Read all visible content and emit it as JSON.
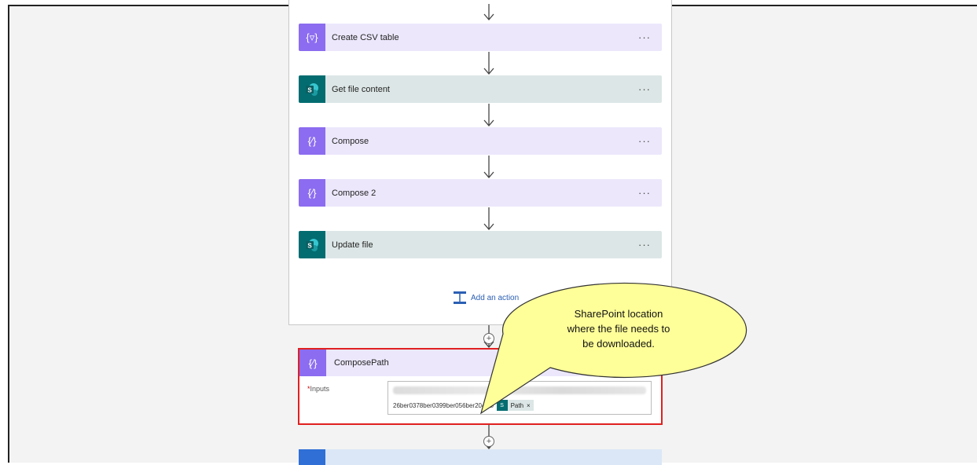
{
  "steps": [
    {
      "label": "Create CSV table",
      "icon": "table-braces-icon",
      "kind": "purple"
    },
    {
      "label": "Get file content",
      "icon": "sharepoint-icon",
      "kind": "teal"
    },
    {
      "label": "Compose",
      "icon": "compose-braces-icon",
      "kind": "purple"
    },
    {
      "label": "Compose 2",
      "icon": "compose-braces-icon",
      "kind": "purple"
    },
    {
      "label": "Update file",
      "icon": "sharepoint-icon",
      "kind": "teal"
    }
  ],
  "menu_label": "···",
  "add_action_label": "Add an action",
  "compose_path": {
    "title": "ComposePath",
    "inputs_label": "Inputs",
    "required_marker": "*",
    "path_text": "26ber0378ber0399ber056ber2049b/",
    "token_label": "Path",
    "token_remove": "×"
  },
  "callout": {
    "line1": "SharePoint location",
    "line2": "where the file needs to",
    "line3": "be downloaded."
  },
  "colors": {
    "highlight_border": "#e02020",
    "callout_fill": "#ffff99",
    "purple_accent": "#8c6cf0",
    "sharepoint_teal": "#036c70"
  }
}
